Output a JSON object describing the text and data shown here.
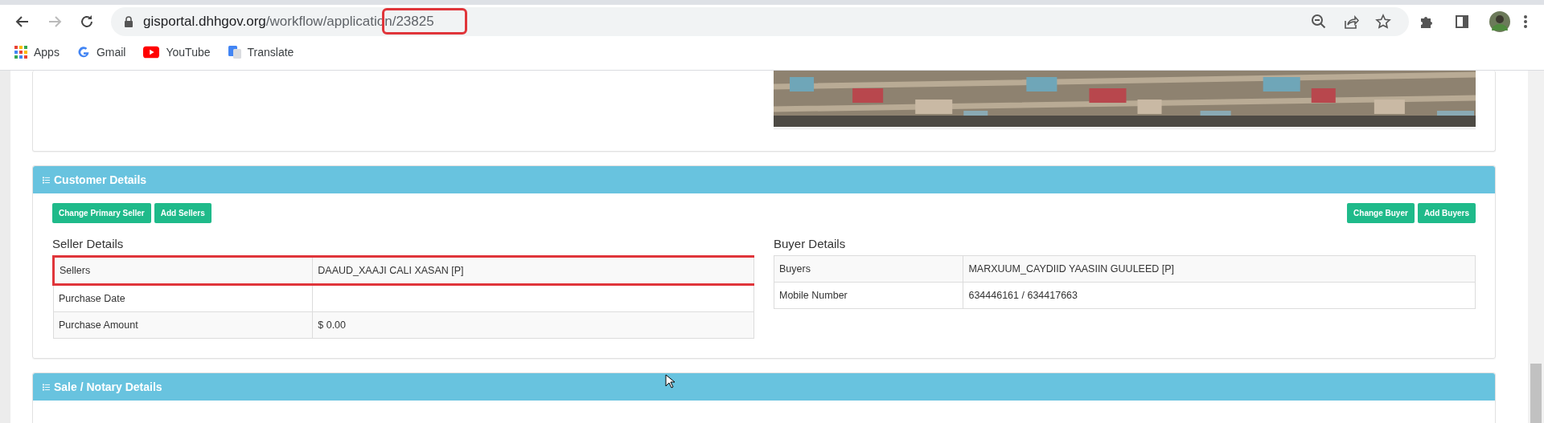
{
  "browser": {
    "url": {
      "host": "gisportal.dhhgov.org",
      "path": "/workflow/applicatio",
      "id": "n/23825",
      "id_highlighted": true
    },
    "bookmarks": [
      {
        "label": "Apps",
        "kind": "apps"
      },
      {
        "label": "Gmail",
        "kind": "google"
      },
      {
        "label": "YouTube",
        "kind": "youtube"
      },
      {
        "label": "Translate",
        "kind": "translate"
      }
    ]
  },
  "customer_details": {
    "title": "Customer Details",
    "seller_buttons": [
      "Change Primary Seller",
      "Add Sellers"
    ],
    "buyer_buttons": [
      "Change Buyer",
      "Add Buyers"
    ],
    "seller": {
      "title": "Seller Details",
      "rows": [
        {
          "label": "Sellers",
          "value": "DAAUD_XAAJI CALI XASAN [P]",
          "highlighted": true
        },
        {
          "label": "Purchase Date",
          "value": "",
          "highlighted": false
        },
        {
          "label": "Purchase Amount",
          "value": "$ 0.00",
          "highlighted": false
        }
      ]
    },
    "buyer": {
      "title": "Buyer Details",
      "rows": [
        {
          "label": "Buyers",
          "value": "MARXUUM_CAYDIID YAASIIN GUULEED [P]",
          "highlighted": false
        },
        {
          "label": "Mobile Number",
          "value": "634446161 / 634417663",
          "highlighted": false
        }
      ]
    }
  },
  "sale_details": {
    "title": "Sale / Notary Details"
  }
}
